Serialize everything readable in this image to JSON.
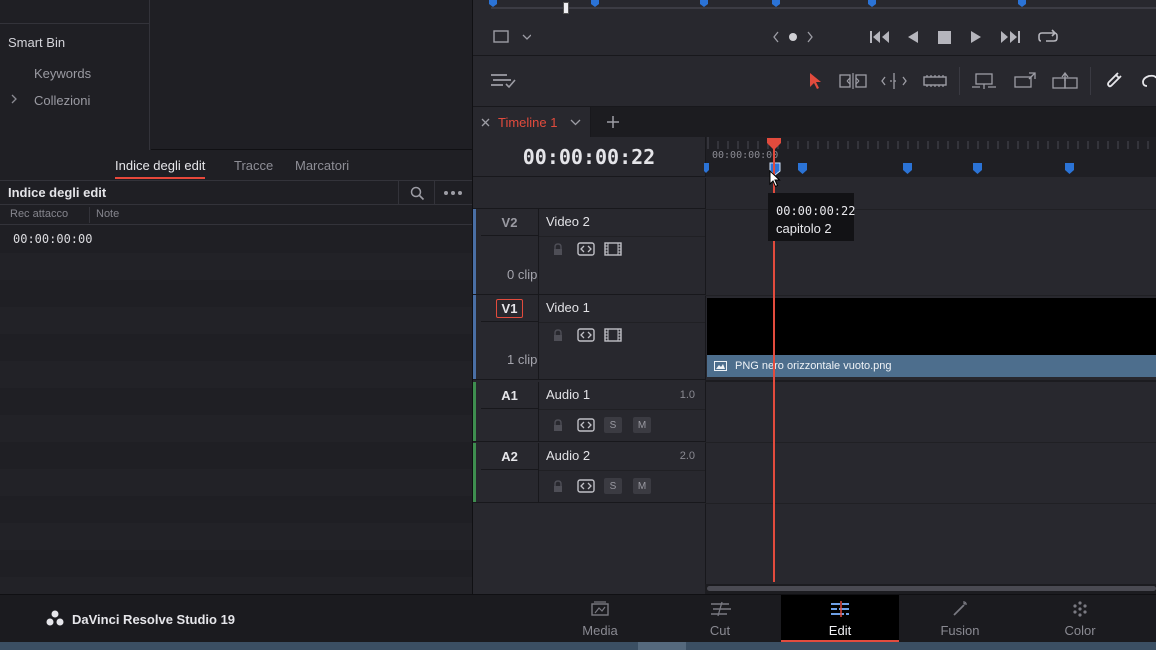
{
  "bins": {
    "smart_bin": "Smart Bin",
    "items": [
      {
        "label": "Keywords"
      },
      {
        "label": "Collezioni"
      }
    ]
  },
  "edit_index": {
    "tabs": [
      {
        "label": "Indice degli edit",
        "active": true
      },
      {
        "label": "Tracce",
        "active": false
      },
      {
        "label": "Marcatori",
        "active": false
      }
    ],
    "title": "Indice degli edit",
    "columns": [
      "Rec attacco",
      "Note"
    ],
    "rows": [
      {
        "rec_in": "00:00:00:00",
        "note": ""
      }
    ]
  },
  "timeline": {
    "tab_label": "Timeline 1",
    "timecode": "00:00:00:22",
    "ruler_start": "00:00:00:00",
    "tooltip": {
      "timecode": "00:00:00:22",
      "name": "capitolo 2"
    },
    "clip_name": "PNG nero orizzontale vuoto.png",
    "tracks": [
      {
        "id": "V2",
        "name": "Video 2",
        "clips": "0 clip",
        "kind": "video",
        "color": "#4a6fa5"
      },
      {
        "id": "V1",
        "name": "Video 1",
        "clips": "1 clip",
        "kind": "video",
        "color": "#4a6fa5"
      },
      {
        "id": "A1",
        "name": "Audio 1",
        "level": "1.0",
        "kind": "audio",
        "color": "#3e8e4f"
      },
      {
        "id": "A2",
        "name": "Audio 2",
        "level": "2.0",
        "kind": "audio",
        "color": "#3e8e4f"
      }
    ],
    "solo_label": "S",
    "mute_label": "M"
  },
  "brand": {
    "name": "DaVinci Resolve Studio 19"
  },
  "pages": [
    {
      "label": "Media",
      "active": false
    },
    {
      "label": "Cut",
      "active": false
    },
    {
      "label": "Edit",
      "active": true
    },
    {
      "label": "Fusion",
      "active": false
    },
    {
      "label": "Color",
      "active": false
    }
  ],
  "colors": {
    "accent": "#e24b3d",
    "clip_label": "#4d6e8d",
    "marker": "#2b73d6"
  }
}
